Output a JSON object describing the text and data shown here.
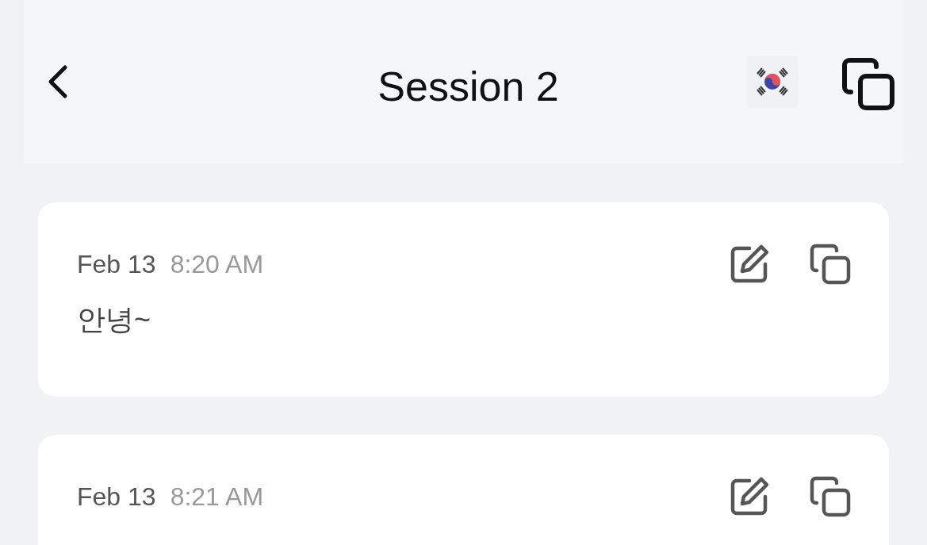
{
  "header": {
    "title": "Session 2"
  },
  "messages": [
    {
      "date": "Feb 13",
      "time": "8:20 AM",
      "text": "안녕~"
    },
    {
      "date": "Feb 13",
      "time": "8:21 AM"
    }
  ]
}
